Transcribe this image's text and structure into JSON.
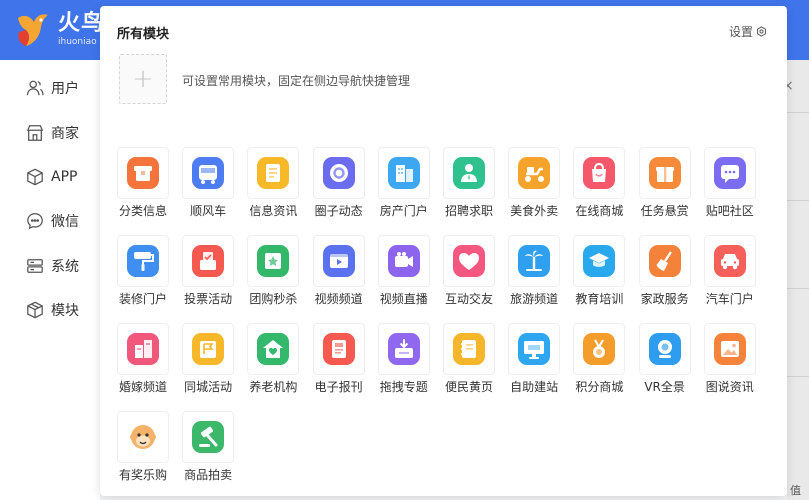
{
  "header": {
    "logo_text": "火鸟",
    "logo_sub": "ihuoniao"
  },
  "sidebar": {
    "items": [
      {
        "label": "用户",
        "icon": "user-icon"
      },
      {
        "label": "商家",
        "icon": "store-icon"
      },
      {
        "label": "APP",
        "icon": "cube-icon"
      },
      {
        "label": "微信",
        "icon": "chat-icon"
      },
      {
        "label": "系统",
        "icon": "server-icon"
      },
      {
        "label": "模块",
        "icon": "module-icon"
      }
    ]
  },
  "panel": {
    "title": "所有模块",
    "settings_label": "设置",
    "add_symbol": "+",
    "hint": "可设置常用模块，固定在侧边导航快捷管理"
  },
  "background": {
    "close_symbol": "×",
    "corner_text": "值"
  },
  "modules": [
    {
      "label": "分类信息",
      "icon": "box-icon",
      "color": "#f5743b"
    },
    {
      "label": "顺风车",
      "icon": "bus-icon",
      "color": "#4d7cf3"
    },
    {
      "label": "信息资讯",
      "icon": "document-icon",
      "color": "#f7b928"
    },
    {
      "label": "圈子动态",
      "icon": "circle-icon",
      "color": "#6b6cf0"
    },
    {
      "label": "房产门户",
      "icon": "building-icon",
      "color": "#3ea7f2"
    },
    {
      "label": "招聘求职",
      "icon": "person-icon",
      "color": "#2fc28e"
    },
    {
      "label": "美食外卖",
      "icon": "scooter-icon",
      "color": "#f5a32b"
    },
    {
      "label": "在线商城",
      "icon": "shop-bag-icon",
      "color": "#f4586a"
    },
    {
      "label": "任务悬赏",
      "icon": "gift-icon",
      "color": "#f58a3b"
    },
    {
      "label": "贴吧社区",
      "icon": "message-icon",
      "color": "#7b6cf2"
    },
    {
      "label": "装修门户",
      "icon": "paint-roller-icon",
      "color": "#3f8ff2"
    },
    {
      "label": "投票活动",
      "icon": "ballot-icon",
      "color": "#f5594f"
    },
    {
      "label": "团购秒杀",
      "icon": "coupon-icon",
      "color": "#33b86a"
    },
    {
      "label": "视频频道",
      "icon": "video-icon",
      "color": "#5a72f0"
    },
    {
      "label": "视频直播",
      "icon": "camera-icon",
      "color": "#8c64ee"
    },
    {
      "label": "互动交友",
      "icon": "heart-icon",
      "color": "#f4577f"
    },
    {
      "label": "旅游频道",
      "icon": "palm-tree-icon",
      "color": "#2f9ff0"
    },
    {
      "label": "教育培训",
      "icon": "graduation-cap-icon",
      "color": "#2aa8ee"
    },
    {
      "label": "家政服务",
      "icon": "broom-icon",
      "color": "#f5823b"
    },
    {
      "label": "汽车门户",
      "icon": "car-icon",
      "color": "#f5605a"
    },
    {
      "label": "婚嫁频道",
      "icon": "wedding-icon",
      "color": "#f2577c"
    },
    {
      "label": "同城活动",
      "icon": "flag-icon",
      "color": "#f6b72a"
    },
    {
      "label": "养老机构",
      "icon": "home-heart-icon",
      "color": "#34b86b"
    },
    {
      "label": "电子报刊",
      "icon": "newspaper-icon",
      "color": "#f5594f"
    },
    {
      "label": "拖拽专题",
      "icon": "drag-icon",
      "color": "#8f68ef"
    },
    {
      "label": "便民黄页",
      "icon": "notebook-icon",
      "color": "#f5b62b"
    },
    {
      "label": "自助建站",
      "icon": "monitor-icon",
      "color": "#2ea7f0"
    },
    {
      "label": "积分商城",
      "icon": "medal-icon",
      "color": "#f59d2b"
    },
    {
      "label": "VR全景",
      "icon": "vr-camera-icon",
      "color": "#2e9df0"
    },
    {
      "label": "图说资讯",
      "icon": "picture-icon",
      "color": "#f5833b"
    },
    {
      "label": "有奖乐购",
      "icon": "monkey-icon",
      "color": "#8a5fe8"
    },
    {
      "label": "商品拍卖",
      "icon": "gavel-icon",
      "color": "#3cb86b"
    }
  ]
}
